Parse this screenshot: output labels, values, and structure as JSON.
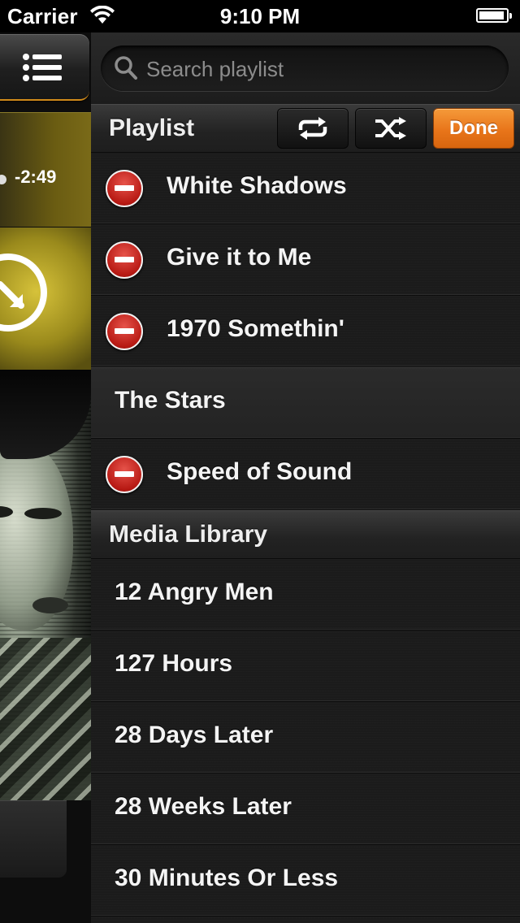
{
  "status_bar": {
    "carrier": "Carrier",
    "time": "9:10 PM",
    "battery_level": 0.95
  },
  "player": {
    "time_remaining": "-2:49",
    "icons": [
      "menu-icon",
      "fullscreen-icon"
    ]
  },
  "search": {
    "placeholder": "Search playlist",
    "value": ""
  },
  "playlist": {
    "title": "Playlist",
    "repeat_icon": "repeat-icon",
    "shuffle_icon": "shuffle-icon",
    "done_label": "Done",
    "items": [
      {
        "title": "White Shadows",
        "deletable": true
      },
      {
        "title": "Give it to Me",
        "deletable": true
      },
      {
        "title": "1970 Somethin'",
        "deletable": true
      },
      {
        "title": "The Stars",
        "deletable": false,
        "current": true
      },
      {
        "title": "Speed of Sound",
        "deletable": true
      }
    ]
  },
  "media_library": {
    "title": "Media Library",
    "items": [
      {
        "title": "12 Angry Men"
      },
      {
        "title": "127 Hours"
      },
      {
        "title": "28 Days Later"
      },
      {
        "title": "28 Weeks Later"
      },
      {
        "title": "30 Minutes Or Less"
      }
    ]
  },
  "colors": {
    "accent_orange": "#e8751a",
    "delete_red": "#c41f18",
    "progress_gold": "#7a6a18"
  }
}
